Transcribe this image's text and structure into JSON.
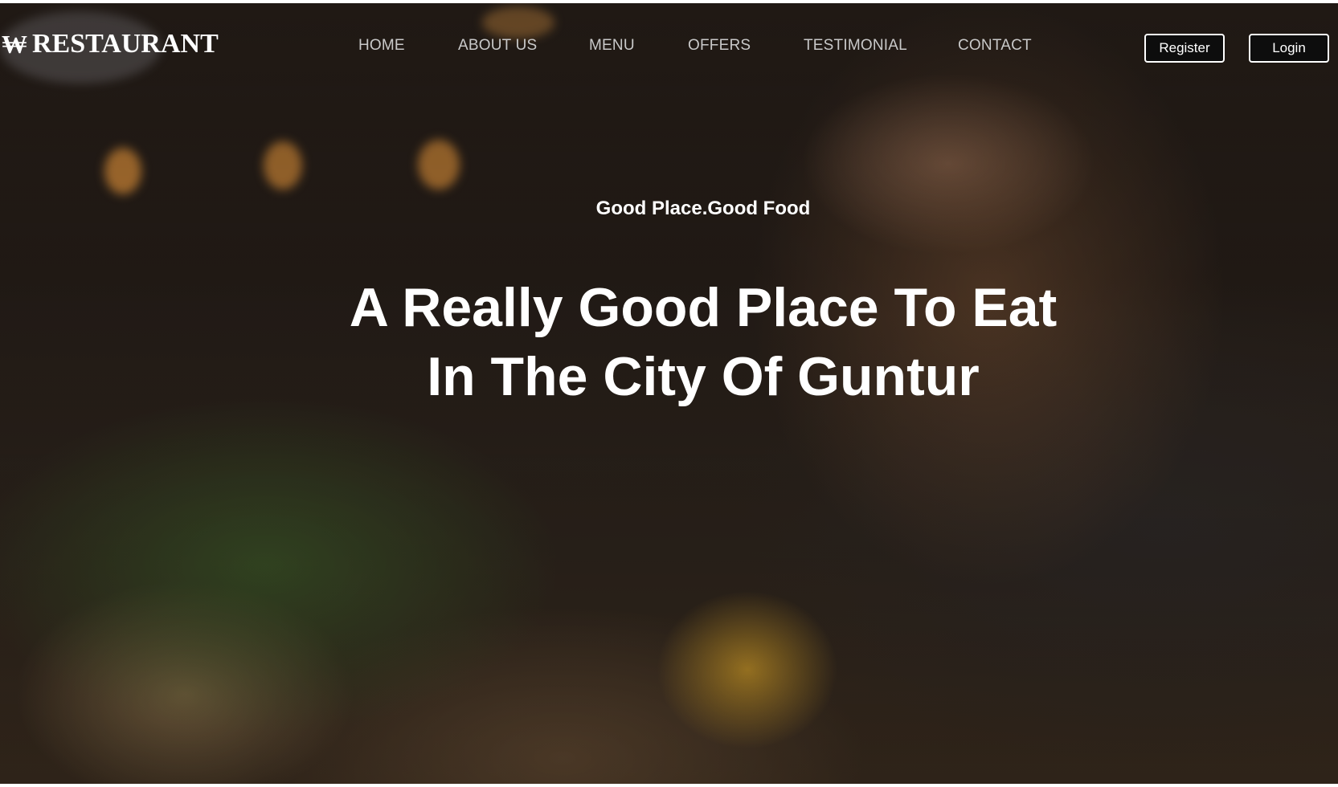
{
  "brand": {
    "icon": "won-sign-icon",
    "icon_glyph": "₩",
    "name": "RESTAURANT"
  },
  "nav": {
    "items": [
      {
        "label": "HOME"
      },
      {
        "label": "ABOUT US"
      },
      {
        "label": "MENU"
      },
      {
        "label": "OFFERS"
      },
      {
        "label": "TESTIMONIAL"
      },
      {
        "label": "CONTACT"
      }
    ]
  },
  "auth": {
    "register_label": "Register",
    "login_label": "Login"
  },
  "hero": {
    "tagline": "Good Place.Good Food",
    "headline_line1": "A Really Good Place To Eat",
    "headline_line2": "In The City Of Guntur"
  },
  "colors": {
    "nav_text": "#c9c9c9",
    "text": "#ffffff",
    "button_bg": "#0d0d0d"
  }
}
